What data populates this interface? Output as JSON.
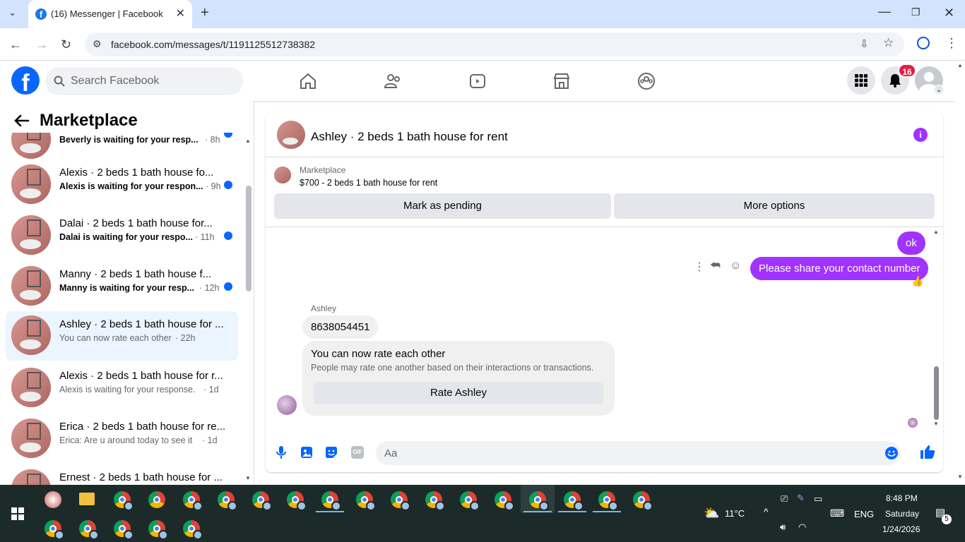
{
  "browser": {
    "tab_title": "(16) Messenger | Facebook",
    "url": "facebook.com/messages/t/1191125512738382"
  },
  "fb": {
    "search_placeholder": "Search Facebook",
    "notif_count": "16"
  },
  "left": {
    "title": "Marketplace",
    "conversations": [
      {
        "name": "",
        "sub": "Beverly is waiting for your resp...",
        "time": "· 8h",
        "unread": true
      },
      {
        "name": "Alexis · 2 beds 1 bath house fo...",
        "sub": "Alexis is waiting for your respon...",
        "time": "· 9h",
        "unread": true
      },
      {
        "name": "Dalai · 2 beds 1 bath house for...",
        "sub": "Dalai is waiting for your respo...",
        "time": "· 11h",
        "unread": true
      },
      {
        "name": "Manny · 2 beds 1 bath house f...",
        "sub": "Manny is waiting for your resp...",
        "time": "· 12h",
        "unread": true
      },
      {
        "name": "Ashley · 2 beds 1 bath house for ...",
        "sub": "You can now rate each other",
        "time": "· 22h",
        "unread": false
      },
      {
        "name": "Alexis · 2 beds 1 bath house for r...",
        "sub": "Alexis is waiting for your response.",
        "time": "· 1d",
        "unread": false
      },
      {
        "name": "Erica · 2 beds 1 bath house for re...",
        "sub": "Erica: Are u around today to see it",
        "time": "· 1d",
        "unread": false
      },
      {
        "name": "Ernest · 2 beds 1 bath house for ...",
        "sub": "",
        "time": "",
        "unread": false
      }
    ]
  },
  "chat": {
    "title": "Ashley · 2 beds 1 bath house for rent",
    "listing_label": "Marketplace",
    "listing_price": "$700 - 2 beds 1 bath house for rent",
    "pending_btn": "Mark as pending",
    "more_btn": "More options",
    "msg_ok": "ok",
    "msg_contact": "Please share your contact number",
    "sender_name": "Ashley",
    "msg_number": "8638054451",
    "rate_title": "You can now rate each other",
    "rate_desc": "People may rate one another based on their interactions or transactions.",
    "rate_btn": "Rate Ashley",
    "composer_placeholder": "Aa"
  },
  "taskbar": {
    "weather": "11°C",
    "lang": "ENG",
    "time": "8:48 PM",
    "day": "Saturday",
    "date": "1/24/2026",
    "notif": "5"
  },
  "colors": {
    "accent": "#a033ff",
    "fb_blue": "#0866ff",
    "unread_dot": "#0866ff"
  }
}
